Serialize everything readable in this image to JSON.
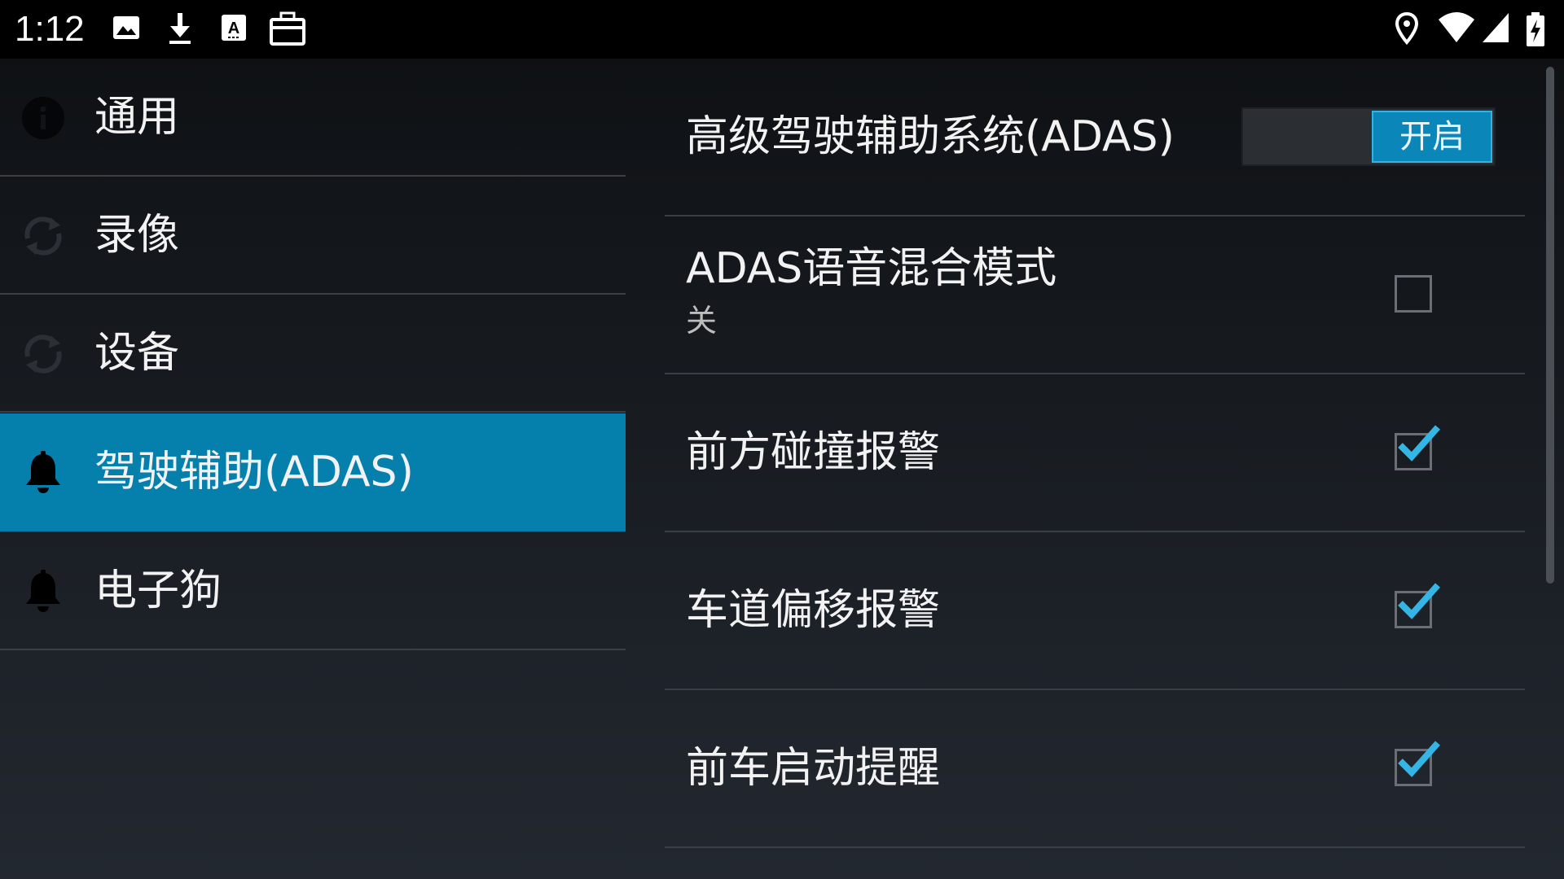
{
  "status_bar": {
    "time": "1:12",
    "left_icons": [
      "image-icon",
      "download-icon",
      "a-badge-icon",
      "toolbox-icon"
    ],
    "right_icons": [
      "location-icon",
      "wifi-icon",
      "signal-icon",
      "battery-charging-icon"
    ]
  },
  "sidebar": {
    "items": [
      {
        "label": "通用",
        "icon": "info-icon",
        "selected": false
      },
      {
        "label": "录像",
        "icon": "sync-icon",
        "selected": false
      },
      {
        "label": "设备",
        "icon": "sync-icon",
        "selected": false
      },
      {
        "label": "驾驶辅助(ADAS)",
        "icon": "bell-icon",
        "selected": true
      },
      {
        "label": "电子狗",
        "icon": "bell-icon",
        "selected": false
      }
    ]
  },
  "preferences": {
    "items": [
      {
        "title": "高级驾驶辅助系统(ADAS)",
        "control": "switch",
        "switch_label": "开启",
        "checked": true
      },
      {
        "title": "ADAS语音混合模式",
        "summary": "关",
        "control": "checkbox",
        "checked": false
      },
      {
        "title": "前方碰撞报警",
        "control": "checkbox",
        "checked": true
      },
      {
        "title": "车道偏移报警",
        "control": "checkbox",
        "checked": true
      },
      {
        "title": "前车启动提醒",
        "control": "checkbox",
        "checked": true
      }
    ]
  },
  "colors": {
    "selected_bg": "#0580ad",
    "check_accent": "#33b5e5",
    "switch_on": "#0a86b9"
  }
}
